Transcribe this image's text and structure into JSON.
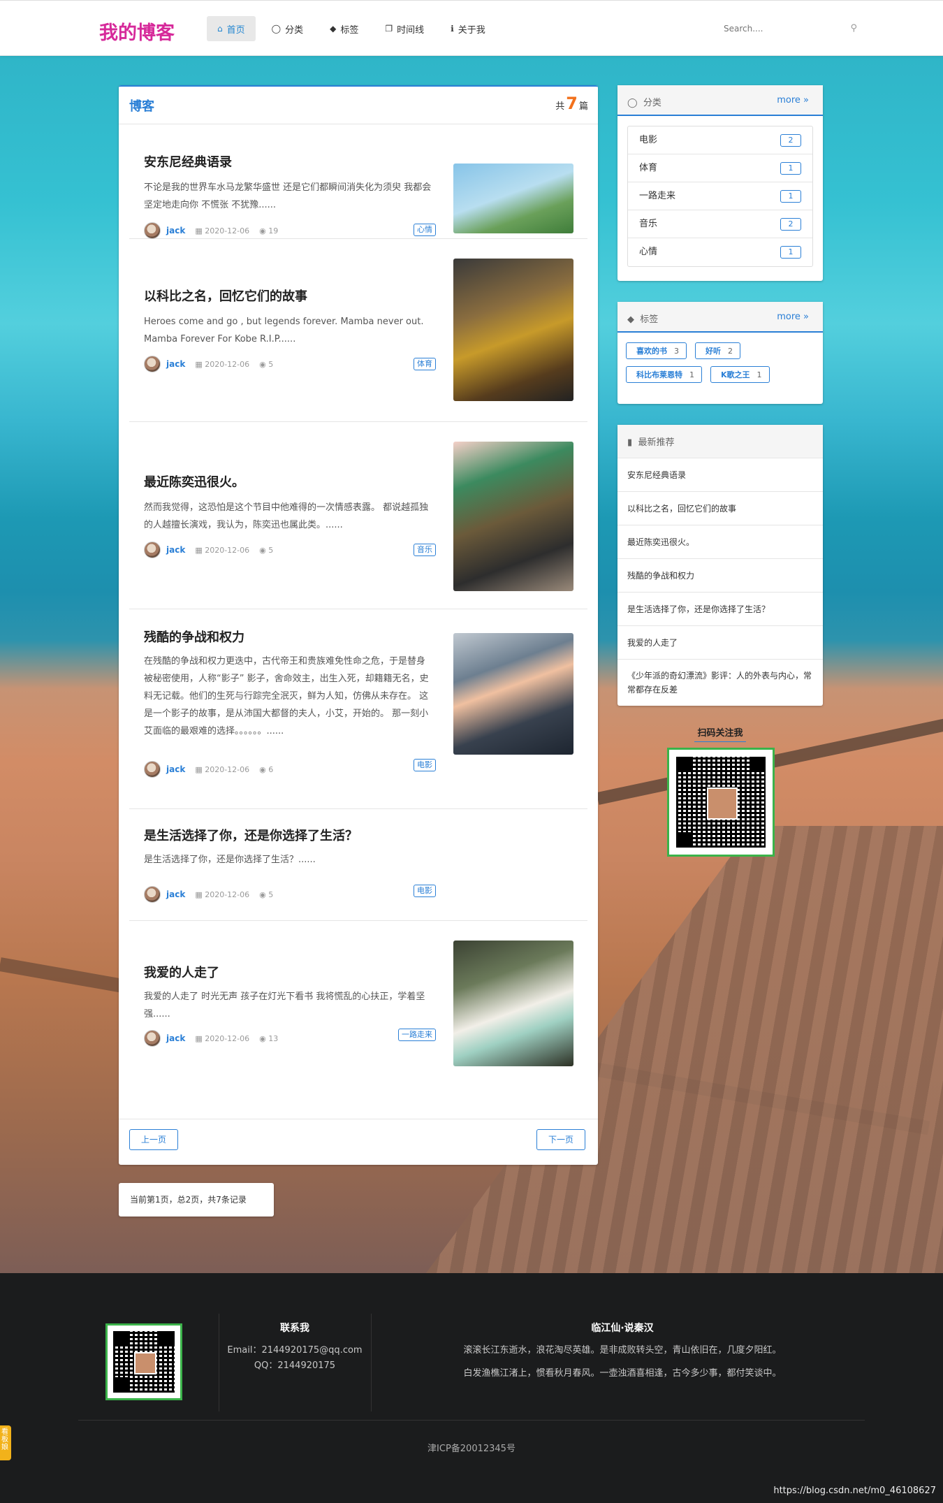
{
  "nav": {
    "brand": "我的博客",
    "items": [
      {
        "label": "首页",
        "icon": "home-icon",
        "active": true
      },
      {
        "label": "分类",
        "icon": "lightbulb-icon",
        "active": false
      },
      {
        "label": "标签",
        "icon": "tags-icon",
        "active": false
      },
      {
        "label": "时间线",
        "icon": "clone-icon",
        "active": false
      },
      {
        "label": "关于我",
        "icon": "info-icon",
        "active": false
      }
    ],
    "search_placeholder": "Search...."
  },
  "main": {
    "title": "博客",
    "count_prefix": "共",
    "count": "7",
    "count_suffix": "篇",
    "posts": [
      {
        "title": "安东尼经典语录",
        "excerpt": "不论是我的世界车水马龙繁华盛世 还是它们都瞬间消失化为须臾 我都会坚定地走向你 不慌张 不犹豫......",
        "author": "jack",
        "date": "2020-12-06",
        "views": "19",
        "tag": "心情"
      },
      {
        "title": "以科比之名，回忆它们的故事",
        "excerpt": "Heroes come and go , but legends forever. Mamba never out. Mamba Forever For Kobe R.I.P......",
        "author": "jack",
        "date": "2020-12-06",
        "views": "5",
        "tag": "体育"
      },
      {
        "title": "最近陈奕迅很火。",
        "excerpt": "然而我觉得，这恐怕是这个节目中他难得的一次情感表露。 都说越孤独的人越擅长演戏，我认为，陈奕迅也属此类。......",
        "author": "jack",
        "date": "2020-12-06",
        "views": "5",
        "tag": "音乐"
      },
      {
        "title": "残酷的争战和权力",
        "excerpt": "在残酷的争战和权力更迭中，古代帝王和贵族难免性命之危，于是替身被秘密使用，人称“影子” 影子，舍命效主，出生入死，却籍籍无名，史料无记载。他们的生死与行踪完全泯灭，鲜为人知，仿佛从未存在。 这是一个影子的故事，是从沛国大都督的夫人，小艾，开始的。 那一刻小艾面临的最艰难的选择。。。。。。......",
        "author": "jack",
        "date": "2020-12-06",
        "views": "6",
        "tag": "电影"
      },
      {
        "title": "是生活选择了你，还是你选择了生活？",
        "excerpt": "是生活选择了你，还是你选择了生活？......",
        "author": "jack",
        "date": "2020-12-06",
        "views": "5",
        "tag": "电影"
      },
      {
        "title": "我爱的人走了",
        "excerpt": "我爱的人走了 时光无声 孩子在灯光下看书 我将慌乱的心扶正，学着坚强......",
        "author": "jack",
        "date": "2020-12-06",
        "views": "13",
        "tag": "一路走来"
      }
    ],
    "prev_label": "上一页",
    "next_label": "下一页",
    "page_info": "当前第1页，总2页，共7条记录"
  },
  "sidebar": {
    "categories_title": "分类",
    "tags_title": "标签",
    "more_label": "more »",
    "categories": [
      {
        "name": "电影",
        "count": "2"
      },
      {
        "name": "体育",
        "count": "1"
      },
      {
        "name": "一路走来",
        "count": "1"
      },
      {
        "name": "音乐",
        "count": "2"
      },
      {
        "name": "心情",
        "count": "1"
      }
    ],
    "tags": [
      {
        "name": "喜欢的书",
        "count": "3"
      },
      {
        "name": "好听",
        "count": "2"
      },
      {
        "name": "科比布莱恩特",
        "count": "1"
      },
      {
        "name": "K歌之王",
        "count": "1"
      }
    ],
    "recommend_title": "最新推荐",
    "recommend": [
      "安东尼经典语录",
      "以科比之名，回忆它们的故事",
      "最近陈奕迅很火。",
      "残酷的争战和权力",
      "是生活选择了你，还是你选择了生活？",
      "我爱的人走了",
      "《少年派的奇幻漂流》影评：人的外表与内心，常常都存在反差"
    ],
    "qr_title": "扫码关注我"
  },
  "footer": {
    "contact_title": "联系我",
    "email": "Email：2144920175@qq.com",
    "qq": "QQ：2144920175",
    "poem_title": "临江仙·说秦汉",
    "poem_line1": "滚滚长江东逝水，浪花淘尽英雄。是非成败转头空，青山依旧在，几度夕阳红。",
    "poem_line2": "白发渔樵江渚上，惯看秋月春风。一壶浊酒喜相逢，古今多少事，都付笑谈中。",
    "icp": "津ICP备20012345号",
    "watermark": "https://blog.csdn.net/m0_46108627",
    "side_tab": "看板娘"
  },
  "colors": {
    "brand": "#d6299a",
    "accent": "#2a7fd6",
    "count": "#f2711c",
    "qr_border": "#3bb34a",
    "footer_bg": "#1b1c1d"
  }
}
